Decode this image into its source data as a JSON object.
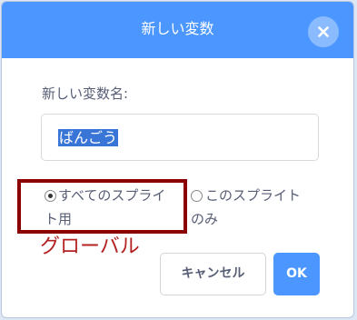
{
  "dialog": {
    "title": "新しい変数",
    "close_icon": "close-icon"
  },
  "form": {
    "name_label": "新しい変数名:",
    "name_value": "ばんごう"
  },
  "scope_options": {
    "all_sprites": {
      "label_line1": "すべてのスプライ",
      "label_line2": "ト用",
      "selected": true
    },
    "this_sprite": {
      "label_line1": "このスプライト",
      "label_line2": "のみ",
      "selected": false
    }
  },
  "annotation": {
    "text": "グローバル",
    "color": "#b22222",
    "box_color": "#8b0000"
  },
  "buttons": {
    "cancel_label": "キャンセル",
    "ok_label": "OK"
  },
  "colors": {
    "header": "#4c97ff",
    "text": "#575e75",
    "selection": "#3875d7"
  }
}
